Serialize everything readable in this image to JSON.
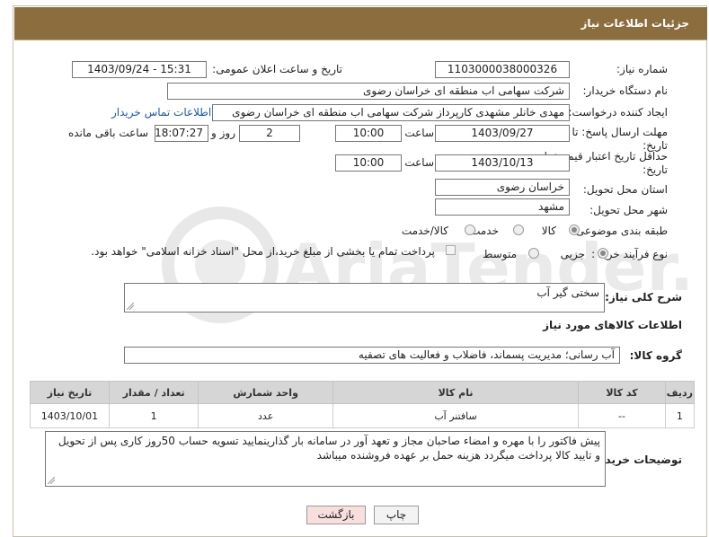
{
  "header": {
    "title": "جزئیات اطلاعات نیاز"
  },
  "form": {
    "need_number_label": "شماره نیاز:",
    "need_number": "1103000038000326",
    "announce_label": "تاریخ و ساعت اعلان عمومی:",
    "announce_value": "1403/09/24 - 15:31",
    "buyer_label": "نام دستگاه خریدار:",
    "buyer_value": "شرکت سهامی اب منطقه ای خراسان رضوی",
    "creator_label": "ایجاد کننده درخواست:",
    "creator_value": "مهدی خانلر مشهدی کارپرداز شرکت سهامی اب منطقه ای خراسان رضوی",
    "contact_link": "اطلاعات تماس خریدار",
    "deadline_label_1": "مهلت ارسال پاسخ: تا",
    "deadline_label_2": "تاریخ:",
    "deadline_date": "1403/09/27",
    "time_label": "ساعت",
    "deadline_time": "10:00",
    "days_value": "2",
    "days_label": "روز و",
    "remaining_time": "18:07:27",
    "remaining_label": "ساعت باقی مانده",
    "validity_label_1": "حداقل تاریخ اعتبار قیمت: تا",
    "validity_label_2": "تاریخ:",
    "validity_date": "1403/10/13",
    "validity_time_label": "ساعت",
    "validity_time": "10:00",
    "province_label": "استان محل تحویل:",
    "province_value": "خراسان رضوی",
    "city_label": "شهر محل تحویل:",
    "city_value": "مشهد",
    "category_label": "طبقه بندی موضوعی:",
    "category_options": [
      "کالا",
      "خدمت",
      "کالا/خدمت"
    ],
    "process_label": "نوع فرآیند خرید :",
    "process_options": [
      "جزیی",
      "متوسط"
    ],
    "payment_note": "پرداخت تمام یا بخشی از مبلغ خرید،از محل \"اسناد خزانه اسلامی\" خواهد بود."
  },
  "description": {
    "label": "شرح کلی نیاز:",
    "value": "سختی گیر آب"
  },
  "goods_info": {
    "title": "اطلاعات کالاهای مورد نیاز",
    "group_label": "گروه کالا:",
    "group_value": "آب رسانی؛ مدیریت پسماند، فاضلاب و فعالیت های تصفیه"
  },
  "table": {
    "headers": [
      "ردیف",
      "کد کالا",
      "نام کالا",
      "واحد شمارش",
      "تعداد / مقدار",
      "تاریخ نیاز"
    ],
    "rows": [
      [
        "1",
        "--",
        "سافتنر آب",
        "عدد",
        "1",
        "1403/10/01"
      ]
    ]
  },
  "buyer_notes": {
    "label": "توضیحات خریدار:",
    "value": "پیش فاکتور را با مهره و امضاء صاحبان مجاز و تعهد آور در سامانه بار گذارینمایید  تسویه  حساب 50روز کاری پس از تحویل و تایید کالا پرداخت میگردد هزینه حمل بر عهده فروشنده میباشد"
  },
  "buttons": {
    "print": "چاپ",
    "back": "بازگشت"
  },
  "watermark": "AriaTender.neT",
  "colors": {
    "header_bg": "#8b6d3e",
    "link": "#1a5aa8",
    "back_button_bg": "#f9dede"
  }
}
